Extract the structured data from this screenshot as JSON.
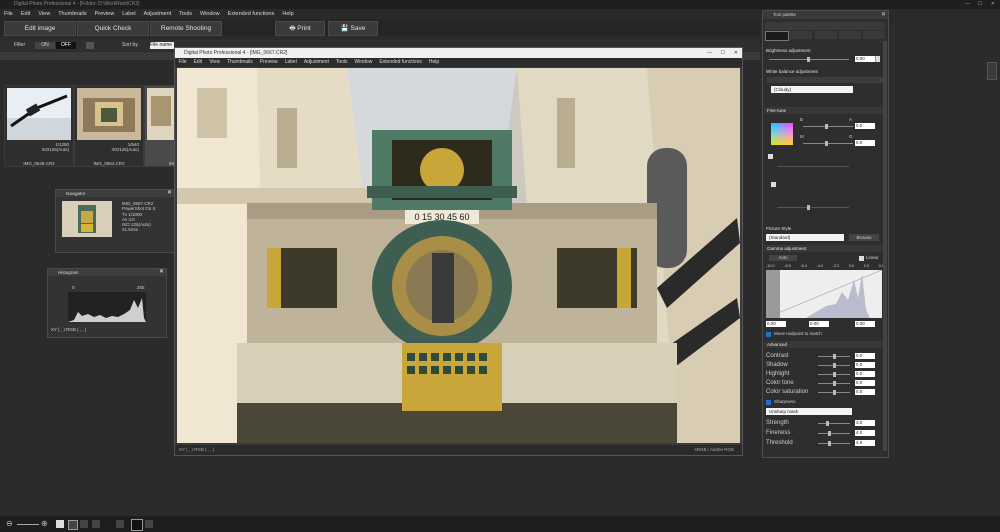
{
  "app": {
    "title": "Digital Photo Professional 4 - [Folder: D:\\WorkRoot\\CR2]"
  },
  "menu": [
    "File",
    "Edit",
    "View",
    "Thumbnails",
    "Preview",
    "Label",
    "Adjustment",
    "Tools",
    "Window",
    "Extended functions",
    "Help"
  ],
  "toolbar": {
    "edit_image": "Edit image",
    "quick_check": "Quick Check",
    "remote_shooting": "Remote Shooting",
    "print": "Print",
    "save": "Save"
  },
  "filterbar": {
    "filter_label": "Filter",
    "on": "ON",
    "off": "OFF",
    "sort_label": "Sort by",
    "sort_value": "File name"
  },
  "thumbnails": [
    {
      "file": "IMG_0648.CR2",
      "shutter": "1/1250",
      "iso": "ISO125(Auto)"
    },
    {
      "file": "IMG_0664.CR2",
      "shutter": "1/640",
      "iso": "ISO125(Auto)"
    },
    {
      "file": "IMG",
      "shutter": "",
      "iso": ""
    }
  ],
  "navigator": {
    "title": "Navigator",
    "lines": [
      "IMG_0667.CR2",
      "PowerShot G5 X",
      "Tv 1/1000",
      "Av 4.0",
      "ISO 125(Auto)",
      "21.5mm"
    ]
  },
  "histogram": {
    "title": "Histogram",
    "min": "0",
    "max": "255",
    "readout": "XY ( , ) RGB ( , , )"
  },
  "image_window": {
    "title": "Digital Photo Professional 4 - [IMG_0667.CR2]",
    "menu": [
      "File",
      "Edit",
      "View",
      "Thumbnails",
      "Preview",
      "Label",
      "Adjustment",
      "Tools",
      "Window",
      "Extended functions",
      "Help"
    ],
    "status_left": "XY ( , ) RGB ( , , )",
    "status_right": "sRGB / Adobe RGB",
    "clock_numbers": "0 15 30 45 60"
  },
  "tool_palette": {
    "title": "Tool palette",
    "brightness": {
      "label": "Brightness adjustment",
      "value": "0.00"
    },
    "white_balance": {
      "label": "White balance adjustment",
      "value": "(Cloudy)"
    },
    "fine_tune": {
      "label": "Fine-tune",
      "b": "B",
      "a": "A",
      "m": "M",
      "g": "G",
      "v1": "0.0",
      "v2": "0.0"
    },
    "picture_style": {
      "label": "Picture Style",
      "value": "(Standard)",
      "browse": "Browse"
    },
    "gamma": {
      "label": "Gamma adjustment",
      "auto": "Auto",
      "linear": "Linear",
      "scale": [
        "-10.0",
        "-8.0",
        "-6.0",
        "-4.0",
        "-2.0",
        "0.0",
        "2.0",
        "4.0"
      ],
      "in_val": "0.00",
      "mid_val": "0.00",
      "out_val": "0.00",
      "midpoint": "Move midpoint to match"
    },
    "advanced": {
      "label": "Advanced",
      "items": [
        {
          "label": "Contrast",
          "value": "0.0"
        },
        {
          "label": "Shadow",
          "value": "0.0"
        },
        {
          "label": "Highlight",
          "value": "0.0"
        },
        {
          "label": "Color tone",
          "value": "0.0"
        },
        {
          "label": "Color saturation",
          "value": "0.0"
        }
      ]
    },
    "sharpness": {
      "label": "Sharpness",
      "mode": "Unsharp mask",
      "items": [
        {
          "label": "Strength",
          "value": "3.0"
        },
        {
          "label": "Fineness",
          "value": "4.0"
        },
        {
          "label": "Threshold",
          "value": "4.0"
        }
      ]
    }
  },
  "colors": {
    "accent": "#1f6fd1",
    "bg": "#2b2b2b"
  }
}
